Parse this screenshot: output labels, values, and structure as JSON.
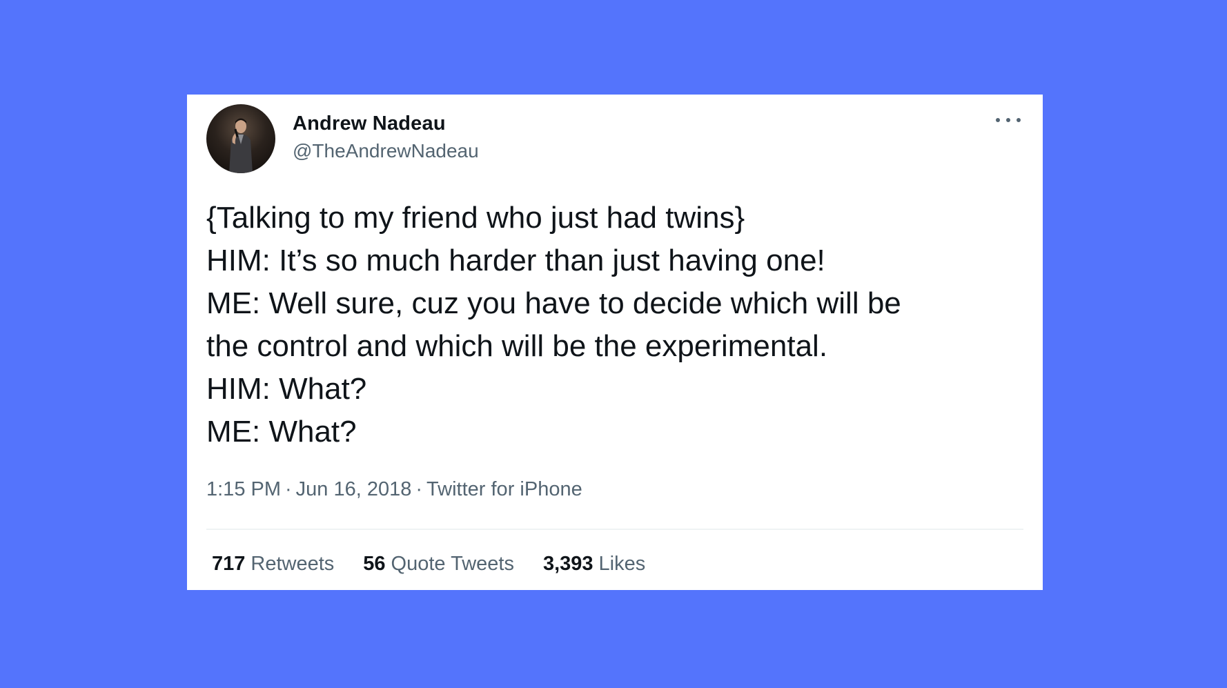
{
  "colors": {
    "background": "#5474FC",
    "card": "#FFFFFF",
    "text_primary": "#0F1419",
    "text_secondary": "#536471"
  },
  "tweet": {
    "author": {
      "display_name": "Andrew Nadeau",
      "handle": "@TheAndrewNadeau",
      "avatar_icon": "avatar-photo"
    },
    "more_icon": "more-horizontal-icon",
    "lines": [
      "{Talking to my friend who just had twins}",
      "HIM: It’s so much harder than just having one!",
      "ME: Well sure, cuz you have to decide which will be",
      "the control and which will be the experimental.",
      "HIM: What?",
      "ME: What?"
    ],
    "time": "1:15 PM",
    "date": "Jun 16, 2018",
    "source": "Twitter for iPhone",
    "separator": "·",
    "stats": {
      "retweets": {
        "count": "717",
        "label": "Retweets"
      },
      "quotes": {
        "count": "56",
        "label": "Quote Tweets"
      },
      "likes": {
        "count": "3,393",
        "label": "Likes"
      }
    }
  }
}
